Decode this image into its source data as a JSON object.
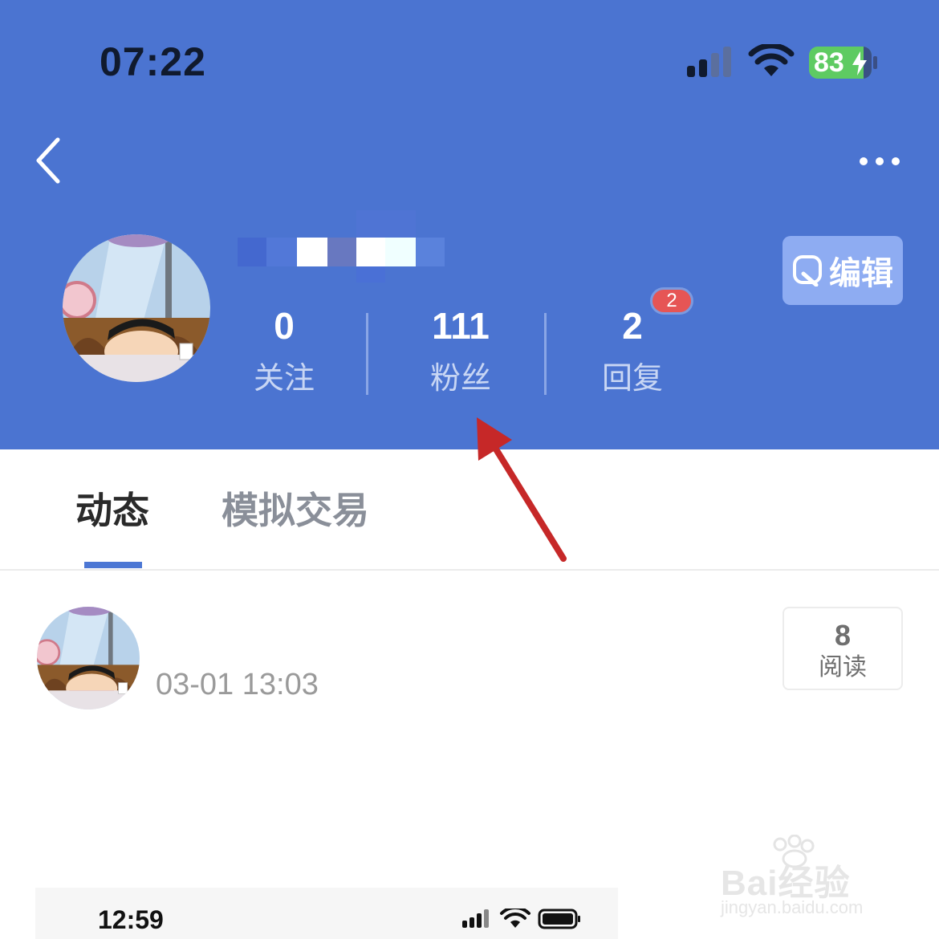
{
  "status_bar": {
    "time": "07:22",
    "battery": "83"
  },
  "header": {
    "edit_label": "编辑"
  },
  "stats": [
    {
      "count": "0",
      "label": "关注"
    },
    {
      "count": "111",
      "label": "粉丝"
    },
    {
      "count": "2",
      "label": "回复",
      "badge": "2"
    }
  ],
  "tabs": [
    {
      "label": "动态"
    },
    {
      "label": "模拟交易"
    }
  ],
  "post": {
    "time": "03-01 13:03",
    "read_count": "8",
    "read_label": "阅读"
  },
  "inset_status_bar": {
    "time": "12:59"
  },
  "watermark": {
    "brand": "Bai经验",
    "url": "jingyan.baidu.com"
  },
  "colors": {
    "header_bg": "#4b74d1",
    "accent": "#4c77d4",
    "badge": "#e65555",
    "arrow": "#c62828",
    "battery": "#5ecb62"
  }
}
